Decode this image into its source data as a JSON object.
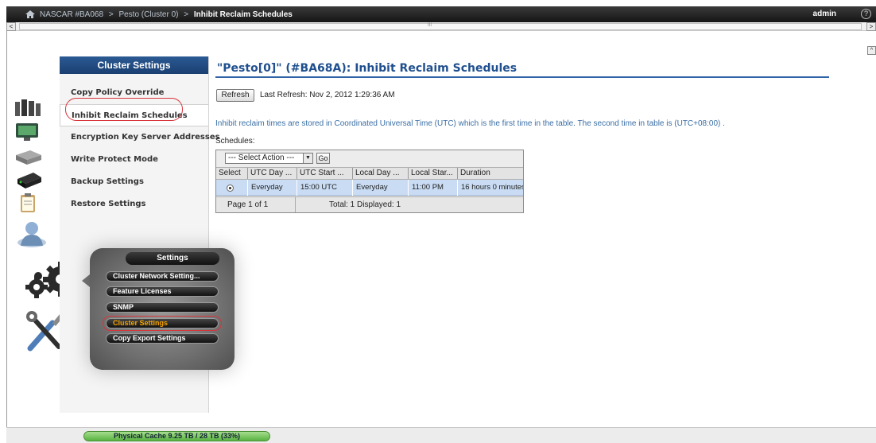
{
  "topbar": {
    "crumbs": [
      "NASCAR #BA068",
      "Pesto (Cluster 0)"
    ],
    "current": "Inhibit Reclaim Schedules",
    "separator": ">",
    "user": "admin",
    "help": "?"
  },
  "scroll": {
    "left": "<",
    "right": ">",
    "up": "^",
    "grip": "III"
  },
  "nav": {
    "heading": "Cluster Settings",
    "items": [
      {
        "label": "Copy Policy Override"
      },
      {
        "label": "Inhibit Reclaim Schedules"
      },
      {
        "label": "Encryption Key Server Addresses"
      },
      {
        "label": "Write Protect Mode"
      },
      {
        "label": "Backup Settings"
      },
      {
        "label": "Restore Settings"
      }
    ],
    "active_index": 1
  },
  "main": {
    "title": "\"Pesto[0]\" (#BA68A): Inhibit Reclaim Schedules",
    "refresh_label": "Refresh",
    "last_refresh": "Last Refresh:  Nov 2, 2012 1:29:36 AM",
    "info": "Inhibit reclaim times are stored in Coordinated Universal Time (UTC) which is the first time in the table. The second time in table is (UTC+08:00) .",
    "schedules_label": "Schedules:"
  },
  "grid": {
    "action_select": "--- Select Action ---",
    "go_label": "Go",
    "headers": [
      "Select",
      "UTC Day ...",
      "UTC Start ...",
      "Local Day ...",
      "Local Star...",
      "Duration"
    ],
    "rows": [
      {
        "utc_day": "Everyday",
        "utc_start": "15:00 UTC",
        "local_day": "Everyday",
        "local_start": "11:00 PM",
        "duration": "16 hours 0 minutes"
      }
    ],
    "footer": {
      "page": "Page 1 of 1",
      "total": "Total: 1   Displayed: 1"
    }
  },
  "popup": {
    "heading": "Settings",
    "items": [
      "Cluster Network Setting...",
      "Feature Licenses",
      "SNMP",
      "Cluster Settings",
      "Copy Export Settings"
    ],
    "highlight_index": 3
  },
  "status": {
    "cache": "Physical Cache 9.25 TB / 28 TB (33%)"
  },
  "colors": {
    "accent": "#1f4f8e",
    "highlight": "#d8333a",
    "row_selected": "#c9dcf3"
  }
}
